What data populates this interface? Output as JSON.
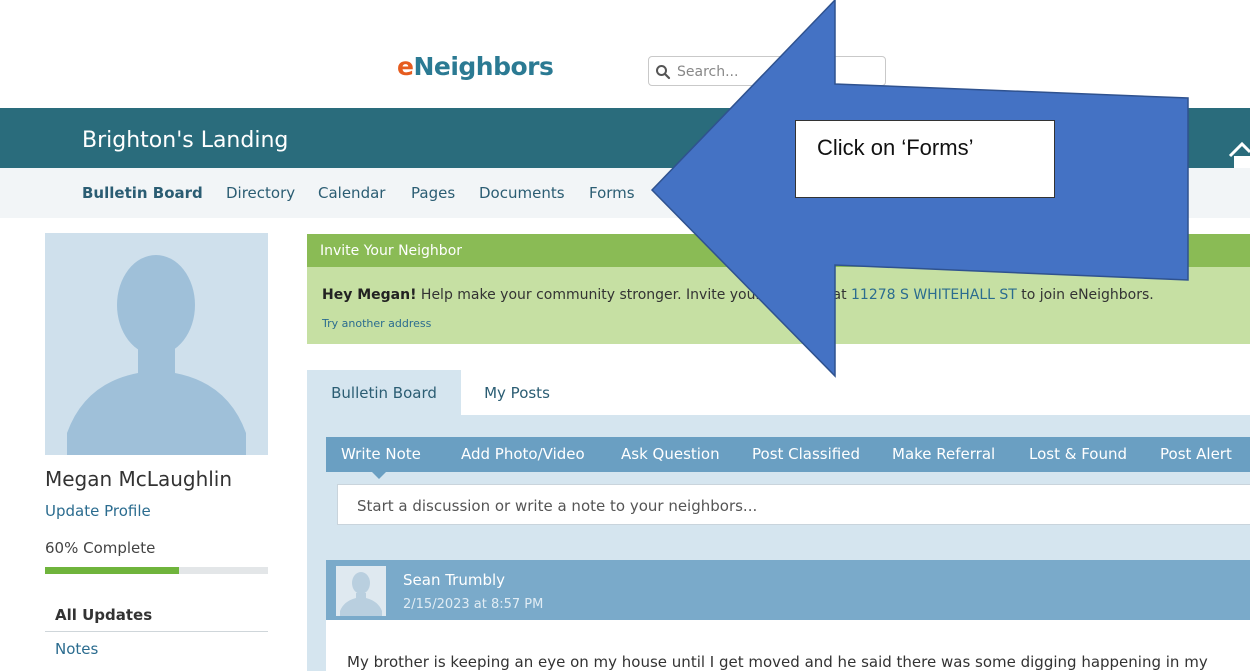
{
  "header": {
    "logo_prefix": "e",
    "logo_rest": "Neighbors",
    "search_placeholder": "Search..."
  },
  "banner": {
    "community_name": "Brighton's Landing"
  },
  "nav": {
    "items": [
      {
        "label": "Bulletin Board"
      },
      {
        "label": "Directory"
      },
      {
        "label": "Calendar"
      },
      {
        "label": "Pages"
      },
      {
        "label": "Documents"
      },
      {
        "label": "Forms"
      }
    ]
  },
  "sidebar": {
    "user_name": "Megan McLaughlin",
    "update_profile": "Update Profile",
    "profile_complete": "60% Complete",
    "profile_progress": 0.6,
    "filters": [
      {
        "label": "All Updates"
      },
      {
        "label": "Notes"
      }
    ]
  },
  "invite": {
    "title": "Invite Your Neighbor",
    "greeting": "Hey Megan!",
    "text_before": " Help make your community stronger. Invite your neighbor at ",
    "address": "11278 S WHITEHALL ST",
    "text_after": " to join eNeighbors.",
    "try_another": "Try another address"
  },
  "tabs": [
    {
      "label": "Bulletin Board"
    },
    {
      "label": "My Posts"
    }
  ],
  "compose": {
    "actions": [
      {
        "label": "Write Note"
      },
      {
        "label": "Add Photo/Video"
      },
      {
        "label": "Ask Question"
      },
      {
        "label": "Post Classified"
      },
      {
        "label": "Make Referral"
      },
      {
        "label": "Lost & Found"
      },
      {
        "label": "Post Alert"
      }
    ],
    "placeholder": "Start a discussion or write a note to your neighbors..."
  },
  "post": {
    "author": "Sean Trumbly",
    "date": "2/15/2023 at 8:57 PM",
    "body": "My brother is keeping an eye on my house until I get moved and he said there was some digging happening in my"
  },
  "annotation": {
    "callout_text": "Click on ‘Forms’",
    "arrow_color": "#4472c4"
  }
}
